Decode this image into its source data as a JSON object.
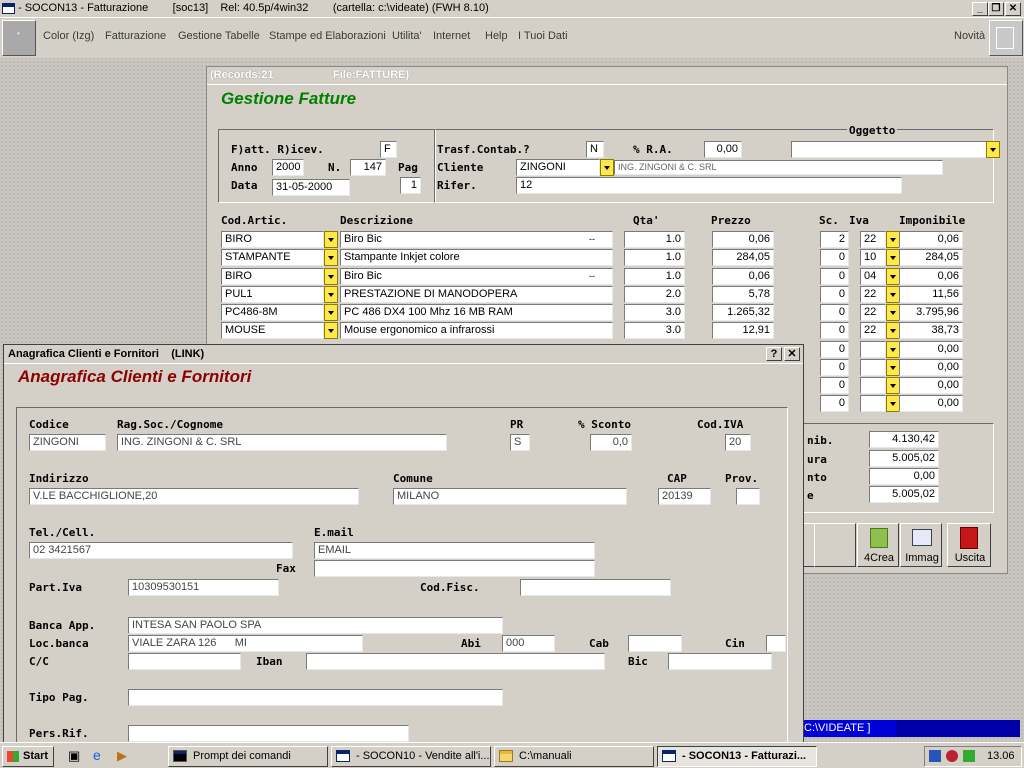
{
  "window": {
    "title": "- SOCON13 - Fatturazione        [soc13]    Rel: 40.5p/4win32        (cartella: c:\\videate) (FWH 8.10)"
  },
  "menu": {
    "items": [
      "Color (Izg)",
      "Fatturazione",
      "Gestione Tabelle",
      "Stampe ed Elaborazioni",
      "Utilita'",
      "Internet",
      "Help",
      "I Tuoi Dati"
    ],
    "right": "Novità"
  },
  "fatture": {
    "records": "(Records:21",
    "file": "File:FATTURE)",
    "title": "Gestione Fatture",
    "oggetto_label": "Oggetto",
    "oggetto_value": "",
    "fatt_label": "F)att. R)icev.",
    "fatt_value": "F",
    "anno_label": "Anno",
    "anno_value": "2000",
    "n_label": "N.",
    "n_value": "147",
    "pag_label": "Pag",
    "pag_value": "1",
    "data_label": "Data",
    "data_value": "31-05-2000",
    "trasf_label": "Trasf.Contab.?",
    "trasf_value": "N",
    "ra_label": "% R.A.",
    "ra_value": "0,00",
    "cliente_label": "Cliente",
    "cliente_value": "ZINGONI",
    "cliente_desc": "ING. ZINGONI & C. SRL",
    "rifer_label": "Rifer.",
    "rifer_value": "12",
    "columns": {
      "cod": "Cod.Artic.",
      "descr": "Descrizione",
      "qta": "Qta'",
      "prezzo": "Prezzo",
      "sc": "Sc.",
      "iva": "Iva",
      "imponibile": "Imponibile"
    },
    "rows": [
      {
        "cod": "BIRO",
        "descr": "Biro Bic",
        "dots": "--",
        "qta": "1.0",
        "prezzo": "0,06",
        "sc": "2",
        "iva": "22",
        "imp": "0,06"
      },
      {
        "cod": "STAMPANTE",
        "descr": "Stampante Inkjet colore",
        "dots": "",
        "qta": "1.0",
        "prezzo": "284,05",
        "sc": "0",
        "iva": "10",
        "imp": "284,05"
      },
      {
        "cod": "BIRO",
        "descr": "Biro Bic",
        "dots": "--",
        "qta": "1.0",
        "prezzo": "0,06",
        "sc": "0",
        "iva": "04",
        "imp": "0,06"
      },
      {
        "cod": "PUL1",
        "descr": "PRESTAZIONE DI MANODOPERA",
        "dots": "",
        "qta": "2.0",
        "prezzo": "5,78",
        "sc": "0",
        "iva": "22",
        "imp": "11,56"
      },
      {
        "cod": "PC486-8M",
        "descr": "PC 486 DX4 100 Mhz 16 MB RAM",
        "dots": "",
        "qta": "3.0",
        "prezzo": "1.265,32",
        "sc": "0",
        "iva": "22",
        "imp": "3.795,96"
      },
      {
        "cod": "MOUSE",
        "descr": "Mouse ergonomico a infrarossi",
        "dots": "",
        "qta": "3.0",
        "prezzo": "12,91",
        "sc": "0",
        "iva": "22",
        "imp": "38,73"
      }
    ],
    "extra_rows": [
      {
        "sc": "0",
        "imp": "0,00"
      },
      {
        "sc": "0",
        "imp": "0,00"
      },
      {
        "sc": "0",
        "imp": "0,00"
      },
      {
        "sc": "0",
        "imp": "0,00"
      }
    ],
    "totals": [
      {
        "label": "nib.",
        "value": "4.130,42"
      },
      {
        "label": "ura",
        "value": "5.005,02"
      },
      {
        "label": "nto",
        "value": "0,00"
      },
      {
        "label": "e",
        "value": "5.005,02"
      }
    ],
    "buttons": {
      "crea": "4Crea",
      "immag": "Immag",
      "uscita": "Uscita"
    },
    "status": "C:\\VIDEATE ]"
  },
  "anagrafica": {
    "window_title": "Anagrafica Clienti e Fornitori    (LINK)",
    "title": "Anagrafica Clienti e Fornitori",
    "codice_label": "Codice",
    "codice_value": "ZINGONI",
    "ragsoc_label": "Rag.Soc./Cognome",
    "ragsoc_value": "ING. ZINGONI & C. SRL",
    "pr_label": "PR",
    "pr_value": "S",
    "sconto_label": "% Sconto",
    "sconto_value": "0,0",
    "codiva_label": "Cod.IVA",
    "codiva_value": "20",
    "indirizzo_label": "Indirizzo",
    "indirizzo_value": "V.LE BACCHIGLIONE,20",
    "comune_label": "Comune",
    "comune_value": "MILANO",
    "cap_label": "CAP",
    "cap_value": "20139",
    "prov_label": "Prov.",
    "prov_value": "",
    "tel_label": "Tel./Cell.",
    "tel_value": "02 3421567",
    "email_label": "E.mail",
    "email_value": "EMAIL",
    "fax_label": "Fax",
    "fax_value": "",
    "piva_label": "Part.Iva",
    "piva_value": "10309530151",
    "codfisc_label": "Cod.Fisc.",
    "codfisc_value": "",
    "banca_label": "Banca App.",
    "banca_value": "INTESA SAN PAOLO SPA",
    "locbanca_label": "Loc.banca",
    "locbanca_value": "VIALE ZARA 126      MI",
    "abi_label": "Abi",
    "abi_value": "000",
    "cab_label": "Cab",
    "cab_value": "",
    "cin_label": "Cin",
    "cin_value": "",
    "cc_label": "C/C",
    "cc_value": "",
    "iban_label": "Iban",
    "iban_value": "",
    "bic_label": "Bic",
    "bic_value": "",
    "tipopag_label": "Tipo Pag.",
    "tipopag_value": "",
    "persrif_label": "Pers.Rif.",
    "persrif_value": ""
  },
  "taskbar": {
    "start": "Start",
    "tasks": [
      "Prompt dei comandi",
      "- SOCON10 - Vendite all'i...",
      "C:\\manuali",
      "- SOCON13 - Fatturazi..."
    ],
    "clock": "13.06"
  }
}
